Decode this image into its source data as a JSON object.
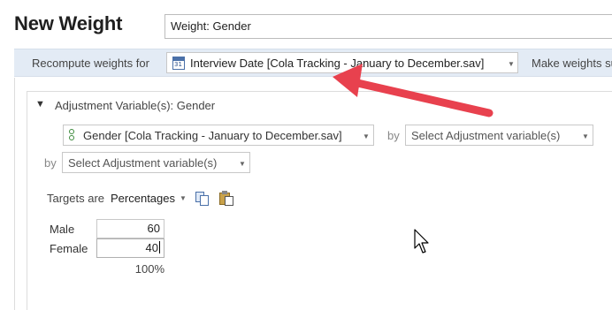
{
  "page": {
    "title": "New Weight"
  },
  "weight_name": {
    "value": "Weight: Gender"
  },
  "recompute": {
    "label": "Recompute weights for",
    "selected": "Interview Date [Cola Tracking - January to December.sav]",
    "make_weights_text": "Make weights sum"
  },
  "adjustment": {
    "header": "Adjustment Variable(s): Gender",
    "variable": "Gender [Cola Tracking - January to December.sav]",
    "by_label": "by",
    "placeholder": "Select Adjustment variable(s)"
  },
  "targets": {
    "label": "Targets are",
    "mode": "Percentages",
    "rows": [
      {
        "label": "Male",
        "value": "60"
      },
      {
        "label": "Female",
        "value": "40"
      }
    ],
    "total": "100%"
  },
  "colors": {
    "recompute_bar": "#e3ebf5",
    "annotation_arrow": "#e8414e"
  },
  "icons": [
    "calendar-icon",
    "chevron-down-icon",
    "variable-icon",
    "copy-icon",
    "paste-icon",
    "mouse-cursor-icon"
  ]
}
